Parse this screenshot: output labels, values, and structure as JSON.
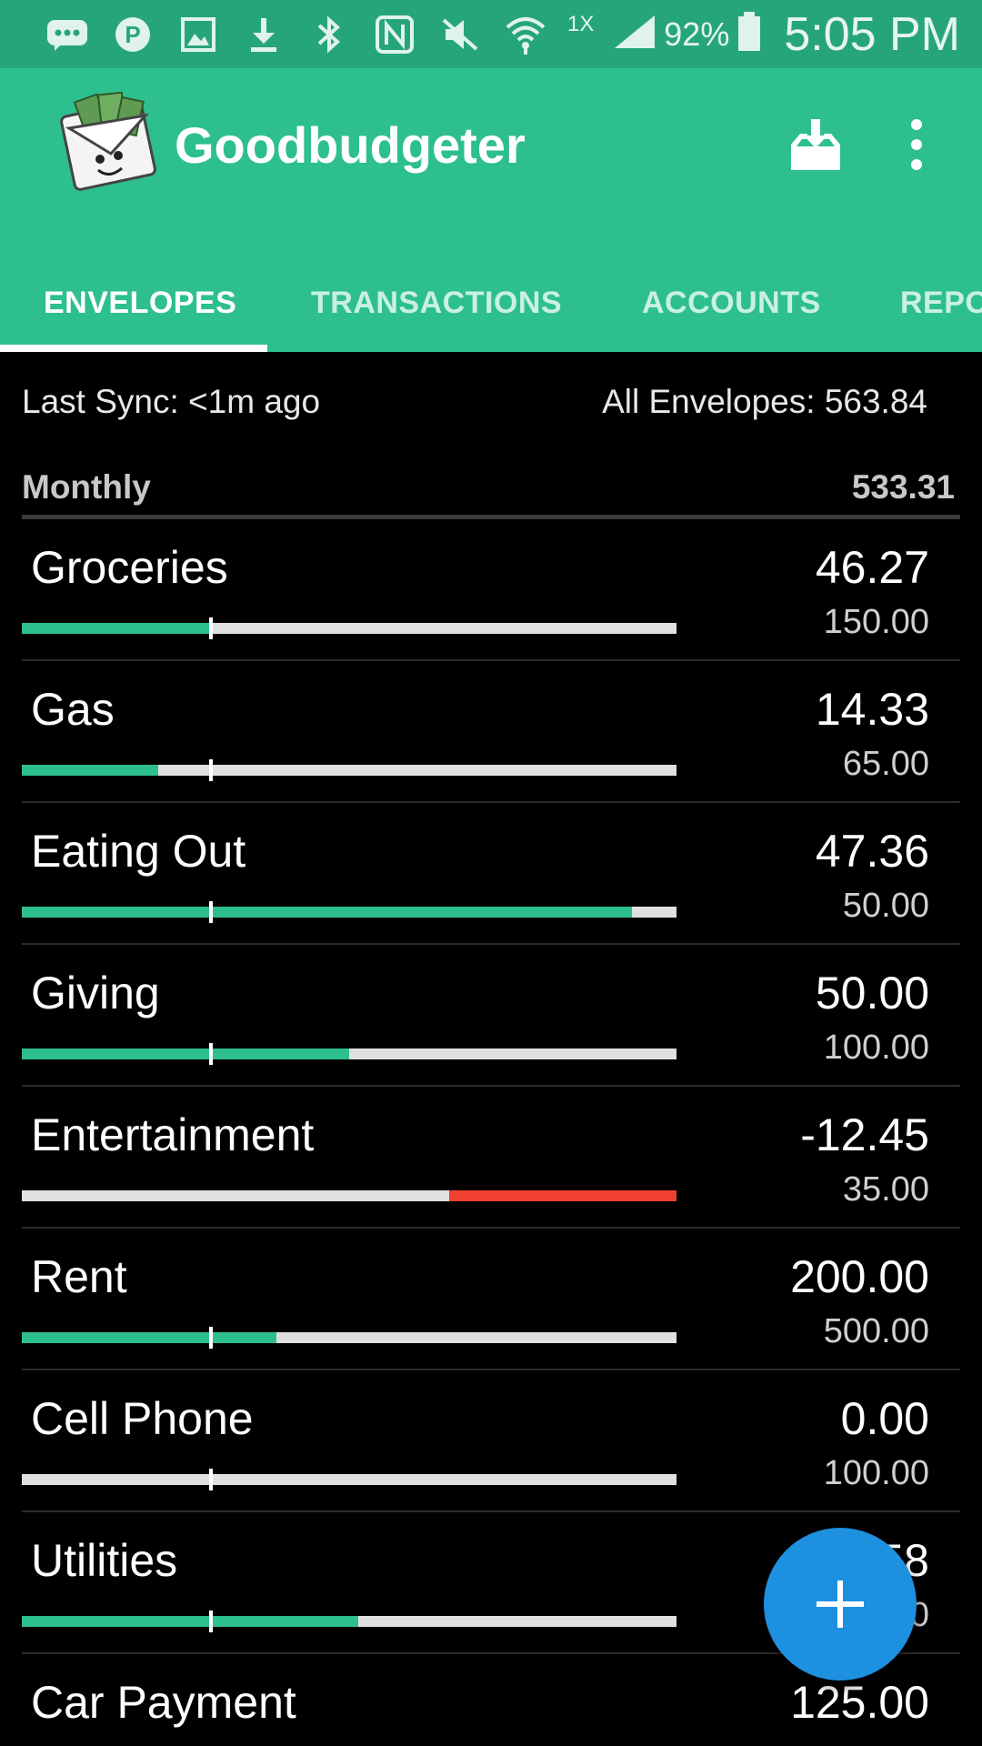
{
  "status_bar": {
    "icons": [
      "message-icon",
      "pinterest-icon",
      "gallery-icon",
      "download-icon",
      "bluetooth-icon",
      "nfc-icon",
      "mute-icon",
      "wifi-icon"
    ],
    "network_label": "1X",
    "battery": "92%",
    "time": "5:05 PM"
  },
  "app": {
    "title": "Goodbudgeter"
  },
  "tabs": [
    {
      "label": "ENVELOPES",
      "active": true
    },
    {
      "label": "TRANSACTIONS",
      "active": false
    },
    {
      "label": "ACCOUNTS",
      "active": false
    },
    {
      "label": "REPO",
      "active": false
    }
  ],
  "summary": {
    "last_sync": "Last Sync: <1m ago",
    "all_envelopes": "All Envelopes: 563.84"
  },
  "group": {
    "name": "Monthly",
    "total": "533.31"
  },
  "envelopes": [
    {
      "name": "Groceries",
      "amount": "46.27",
      "budget": "150.00",
      "fill_fraction": 0.288,
      "overspent_fraction": 0
    },
    {
      "name": "Gas",
      "amount": "14.33",
      "budget": "65.00",
      "fill_fraction": 0.208,
      "overspent_fraction": 0
    },
    {
      "name": "Eating Out",
      "amount": "47.36",
      "budget": "50.00",
      "fill_fraction": 0.932,
      "overspent_fraction": 0
    },
    {
      "name": "Giving",
      "amount": "50.00",
      "budget": "100.00",
      "fill_fraction": 0.5,
      "overspent_fraction": 0
    },
    {
      "name": "Entertainment",
      "amount": "-12.45",
      "budget": "35.00",
      "fill_fraction": 0,
      "overspent_fraction": 0.347
    },
    {
      "name": "Rent",
      "amount": "200.00",
      "budget": "500.00",
      "fill_fraction": 0.389,
      "overspent_fraction": 0
    },
    {
      "name": "Cell Phone",
      "amount": "0.00",
      "budget": "100.00",
      "fill_fraction": 0,
      "overspent_fraction": 0
    },
    {
      "name": "Utilities",
      "amount": "58",
      "budget": "0",
      "fill_fraction": 0.514,
      "overspent_fraction": 0
    },
    {
      "name": "Car Payment",
      "amount": "125.00",
      "budget": "",
      "fill_fraction": 0,
      "overspent_fraction": 0
    }
  ],
  "colors": {
    "status_bar": "#27a57a",
    "app_bar": "#2ebf8e",
    "progress_fill": "#2ebf8e",
    "progress_overspent": "#f0402f",
    "progress_track": "#e0e0e0",
    "fab": "#1e90e0"
  },
  "fab": {
    "icon": "plus-icon"
  }
}
